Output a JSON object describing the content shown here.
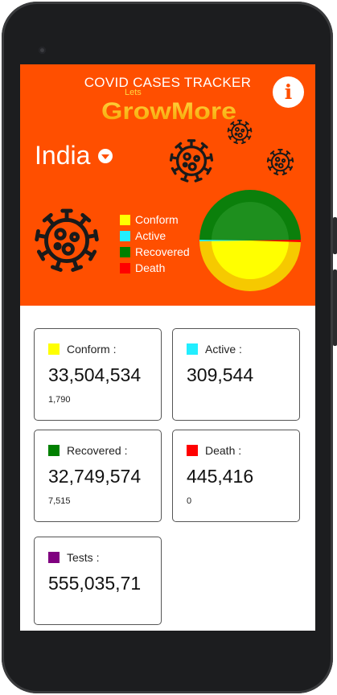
{
  "app": {
    "title": "COVID CASES TRACKER",
    "logo_small": "Lets",
    "logo_main": "GrowMore"
  },
  "location": {
    "country": "India"
  },
  "colors": {
    "header_bg": "#ff4f00",
    "conform": "#ffff00",
    "active": "#22eeff",
    "recovered": "#008000",
    "death": "#ff0000",
    "tests": "#800080"
  },
  "legend": [
    {
      "label": "Conform"
    },
    {
      "label": "Active"
    },
    {
      "label": "Recovered"
    },
    {
      "label": "Death"
    }
  ],
  "cards": {
    "conform": {
      "label": "Conform :",
      "value": "33,504,534",
      "delta": "1,790"
    },
    "active": {
      "label": "Active :",
      "value": "309,544"
    },
    "recovered": {
      "label": "Recovered :",
      "value": "32,749,574",
      "delta": "7,515"
    },
    "death": {
      "label": "Death :",
      "value": "445,416",
      "delta": "0"
    },
    "tests": {
      "label": "Tests :",
      "value": "555,035,71"
    }
  },
  "icons": {
    "info": "info-icon",
    "dropdown": "dropdown-chevron-icon",
    "virus": "virus-icon"
  }
}
